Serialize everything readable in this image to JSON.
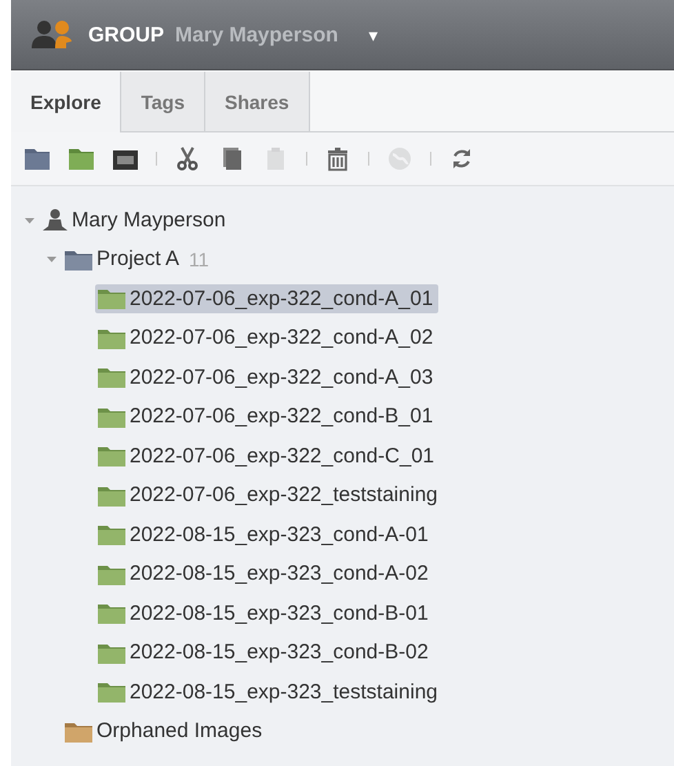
{
  "header": {
    "label": "GROUP",
    "user": "Mary Mayperson",
    "caret": "▾"
  },
  "tabs": [
    {
      "label": "Explore",
      "selected": true
    },
    {
      "label": "Tags",
      "selected": false
    },
    {
      "label": "Shares",
      "selected": false
    }
  ],
  "toolbar": [
    {
      "kind": "project",
      "disabled": false
    },
    {
      "kind": "dataset",
      "disabled": false
    },
    {
      "kind": "plate",
      "disabled": false
    },
    {
      "kind": "separator"
    },
    {
      "kind": "cut",
      "disabled": false
    },
    {
      "kind": "copy",
      "disabled": false
    },
    {
      "kind": "paste",
      "disabled": true
    },
    {
      "kind": "separator"
    },
    {
      "kind": "delete",
      "disabled": false
    },
    {
      "kind": "separator"
    },
    {
      "kind": "share",
      "disabled": true
    },
    {
      "kind": "separator"
    },
    {
      "kind": "refresh",
      "disabled": false
    }
  ],
  "tree": [
    {
      "kind": "user",
      "label": "Mary Mayperson",
      "expanded": true,
      "selected": false,
      "children": [
        {
          "kind": "project",
          "label": "Project A",
          "count": "11",
          "expanded": true,
          "selected": false,
          "children": [
            {
              "kind": "dataset",
              "label": "2022-07-06_exp-322_cond-A_01",
              "selected": true
            },
            {
              "kind": "dataset",
              "label": "2022-07-06_exp-322_cond-A_02",
              "selected": false
            },
            {
              "kind": "dataset",
              "label": "2022-07-06_exp-322_cond-A_03",
              "selected": false
            },
            {
              "kind": "dataset",
              "label": "2022-07-06_exp-322_cond-B_01",
              "selected": false
            },
            {
              "kind": "dataset",
              "label": "2022-07-06_exp-322_cond-C_01",
              "selected": false
            },
            {
              "kind": "dataset",
              "label": "2022-07-06_exp-322_teststaining",
              "selected": false
            },
            {
              "kind": "dataset",
              "label": "2022-08-15_exp-323_cond-A-01",
              "selected": false
            },
            {
              "kind": "dataset",
              "label": "2022-08-15_exp-323_cond-A-02",
              "selected": false
            },
            {
              "kind": "dataset",
              "label": "2022-08-15_exp-323_cond-B-01",
              "selected": false
            },
            {
              "kind": "dataset",
              "label": "2022-08-15_exp-323_cond-B-02",
              "selected": false
            },
            {
              "kind": "dataset",
              "label": "2022-08-15_exp-323_teststaining",
              "selected": false
            }
          ]
        },
        {
          "kind": "orphaned",
          "label": "Orphaned Images",
          "selected": false
        }
      ]
    }
  ]
}
